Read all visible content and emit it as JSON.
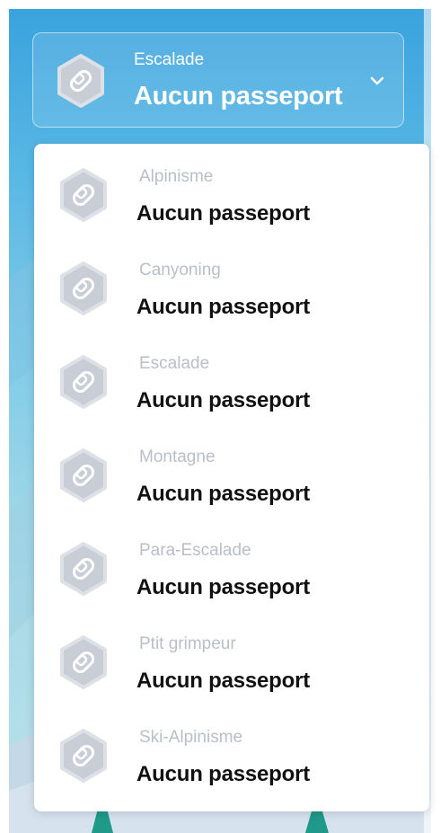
{
  "selector": {
    "category": "Escalade",
    "status": "Aucun passeport",
    "icon": "hexagon-passport-icon",
    "chevron_icon": "chevron-down-icon"
  },
  "dropdown": {
    "items": [
      {
        "category": "Alpinisme",
        "status": "Aucun passeport"
      },
      {
        "category": "Canyoning",
        "status": "Aucun passeport"
      },
      {
        "category": "Escalade",
        "status": "Aucun passeport"
      },
      {
        "category": "Montagne",
        "status": "Aucun passeport"
      },
      {
        "category": "Para-Escalade",
        "status": "Aucun passeport"
      },
      {
        "category": "Ptit grimpeur",
        "status": "Aucun passeport"
      },
      {
        "category": "Ski-Alpinisme",
        "status": "Aucun passeport"
      }
    ]
  },
  "colors": {
    "sky_top": "#3aa2dd",
    "sky_bottom": "#b8e0ea",
    "badge_fill": "#c9ced6",
    "badge_stroke": "#dde1e7",
    "category_text": "#b9bec8",
    "status_text": "#111111"
  }
}
